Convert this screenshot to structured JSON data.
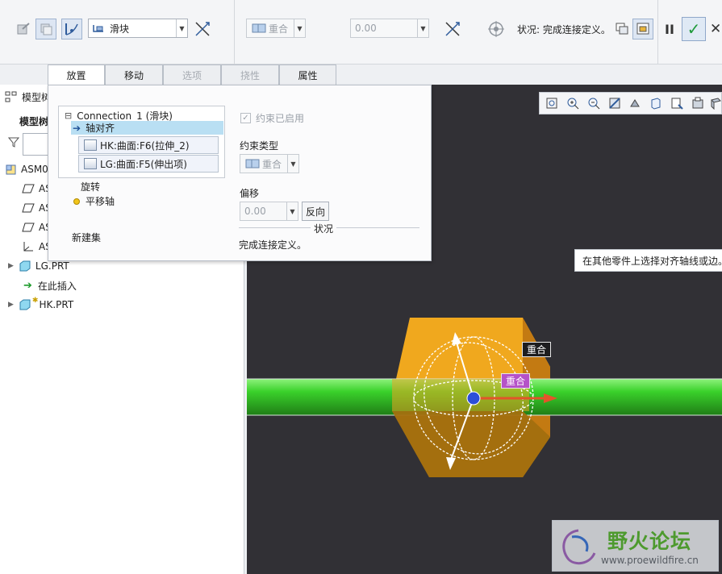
{
  "toolbar": {
    "connection_type": "滑块",
    "constraint_type": "重合",
    "offset_value": "0.00",
    "status_label": "状况:",
    "status_text": "完成连接定义。",
    "pause_label": "II",
    "ok_label": "✓",
    "cancel_label": "✕"
  },
  "tabs": [
    {
      "label": "放置",
      "enabled": true,
      "active": true
    },
    {
      "label": "移动",
      "enabled": true,
      "active": false
    },
    {
      "label": "选项",
      "enabled": false,
      "active": false
    },
    {
      "label": "挠性",
      "enabled": false,
      "active": false
    },
    {
      "label": "属性",
      "enabled": true,
      "active": false
    }
  ],
  "model_tree": {
    "header": "模型树",
    "sub_header": "模型树",
    "items": [
      {
        "label": "ASM0"
      },
      {
        "label": "AS"
      },
      {
        "label": "AS"
      },
      {
        "label": "AS"
      },
      {
        "label": "AS"
      },
      {
        "label": "LG.PRT"
      },
      {
        "label": "在此插入"
      },
      {
        "label": "HK.PRT"
      }
    ]
  },
  "placement": {
    "connection_name": "Connection_1 (滑块)",
    "collapse_glyph": "⊟",
    "axis_align": "轴对齐",
    "refs": [
      "HK:曲面:F6(拉伸_2)",
      "LG:曲面:F5(伸出项)"
    ],
    "rotation": "旋转",
    "translation_axis": "平移轴",
    "new_set": "新建集",
    "constraint_enabled": "约束已启用",
    "constraint_type_label": "约束类型",
    "constraint_type_value": "重合",
    "offset_label": "偏移",
    "offset_value": "0.00",
    "flip_button": "反向",
    "status_title": "状况",
    "status_text": "完成连接定义。"
  },
  "viewport": {
    "hint": "在其他零件上选择对齐轴线或边。",
    "tag_white": "重合",
    "tag_purple": "重合"
  },
  "watermark": {
    "text": "野火论坛",
    "url": "www.proewildfire.cn"
  },
  "colors": {
    "viewport_bg": "#313035",
    "block": "#f0a81e",
    "rod": "#3ad12b",
    "drag_arrow": "#e2552a",
    "tag_purple": "#b552c8"
  }
}
